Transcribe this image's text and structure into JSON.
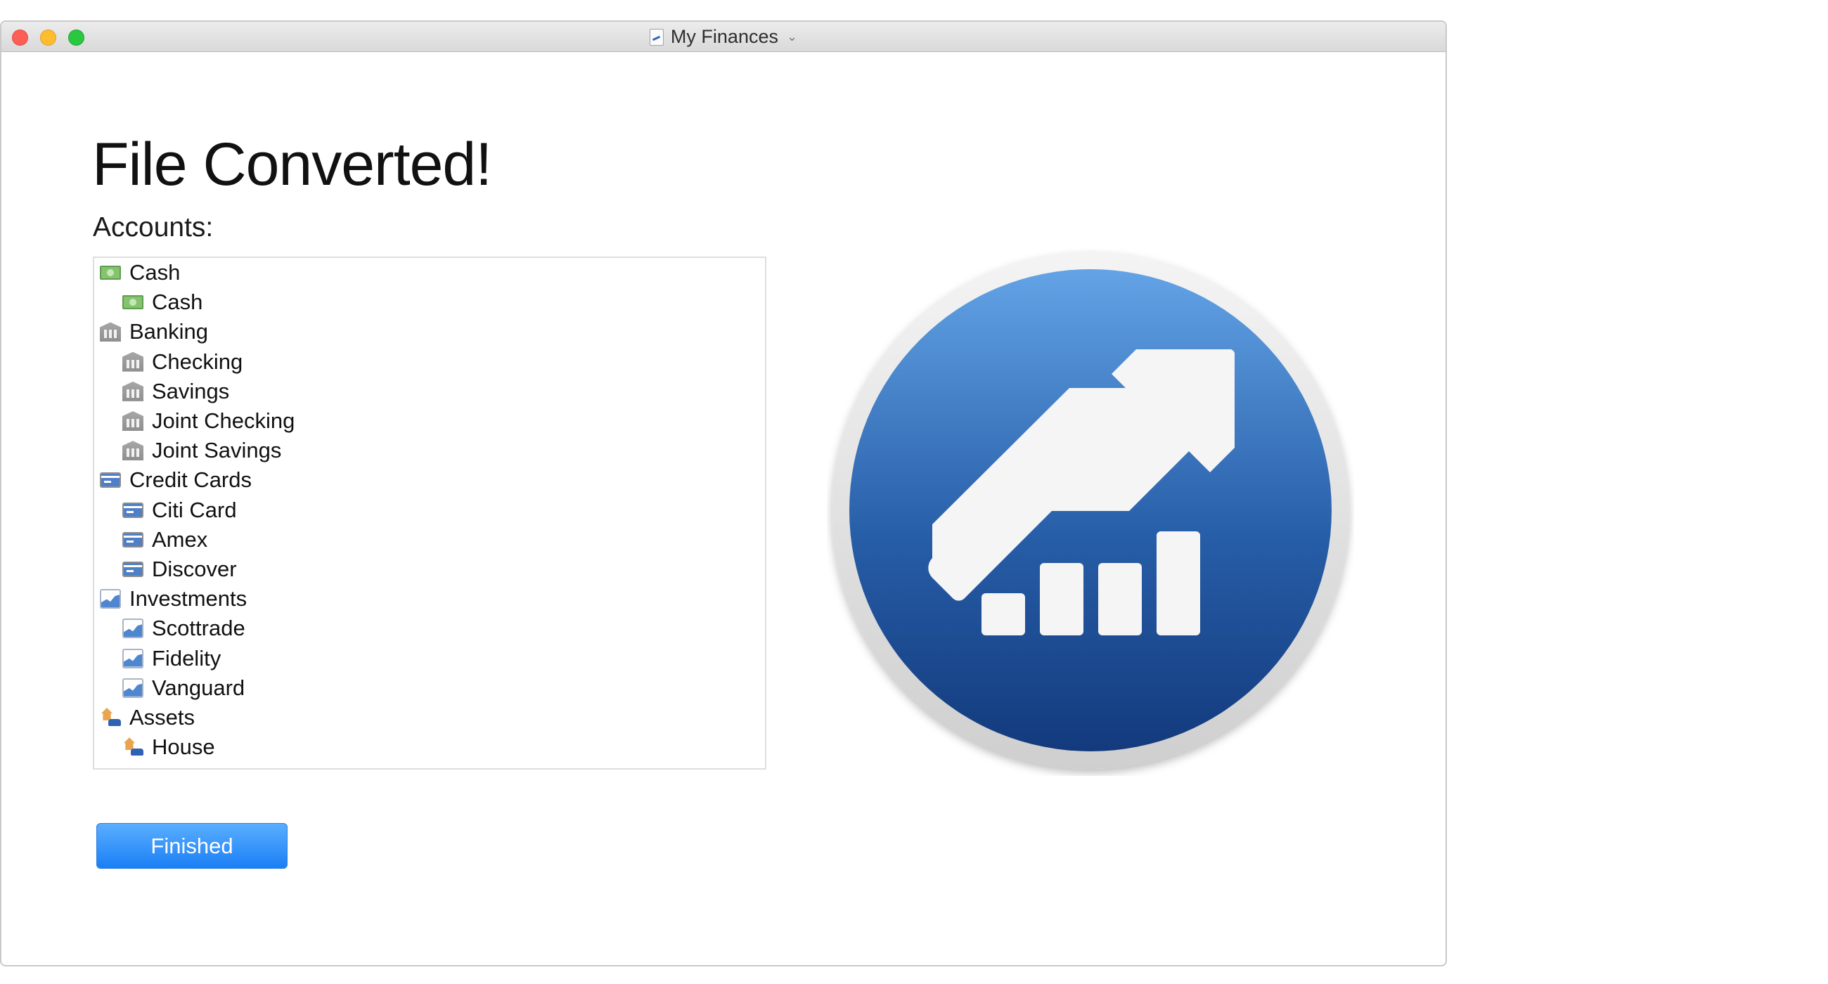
{
  "window": {
    "title": "My Finances",
    "title_chevron": "⌄"
  },
  "main": {
    "heading": "File Converted!",
    "accounts_label": "Accounts:",
    "accounts": [
      {
        "label": "Cash",
        "icon": "cash-icon",
        "level": 0
      },
      {
        "label": "Cash",
        "icon": "cash-icon",
        "level": 1
      },
      {
        "label": "Banking",
        "icon": "bank-icon",
        "level": 0
      },
      {
        "label": "Checking",
        "icon": "bank-icon",
        "level": 1
      },
      {
        "label": "Savings",
        "icon": "bank-icon",
        "level": 1
      },
      {
        "label": "Joint Checking",
        "icon": "bank-icon",
        "level": 1
      },
      {
        "label": "Joint Savings",
        "icon": "bank-icon",
        "level": 1
      },
      {
        "label": "Credit Cards",
        "icon": "credit-card-icon",
        "level": 0
      },
      {
        "label": "Citi Card",
        "icon": "credit-card-icon",
        "level": 1
      },
      {
        "label": "Amex",
        "icon": "credit-card-icon",
        "level": 1
      },
      {
        "label": "Discover",
        "icon": "credit-card-icon",
        "level": 1
      },
      {
        "label": "Investments",
        "icon": "investment-chart-icon",
        "level": 0
      },
      {
        "label": "Scottrade",
        "icon": "investment-chart-icon",
        "level": 1
      },
      {
        "label": "Fidelity",
        "icon": "investment-chart-icon",
        "level": 1
      },
      {
        "label": "Vanguard",
        "icon": "investment-chart-icon",
        "level": 1
      },
      {
        "label": "Assets",
        "icon": "house-car-icon",
        "level": 0
      },
      {
        "label": "House",
        "icon": "house-car-icon",
        "level": 1
      }
    ],
    "finished_button": "Finished"
  },
  "logo": {
    "icon": "app-logo-growth-arrow-icon",
    "colors": {
      "ring": "#e6e6e6",
      "disc_top": "#63a3e6",
      "disc_bottom": "#133a7d",
      "glyph": "#f5f5f5"
    }
  }
}
